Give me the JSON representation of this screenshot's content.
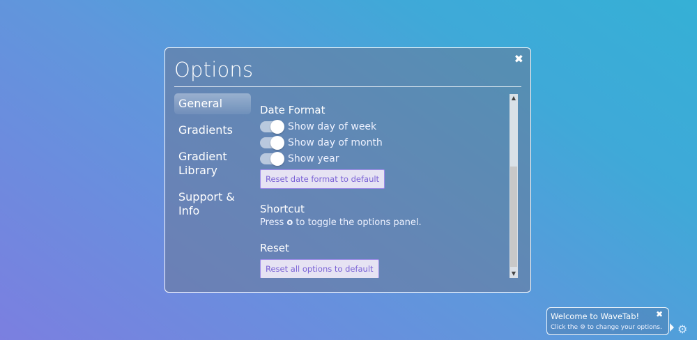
{
  "modal": {
    "title": "Options",
    "close_glyph": "✖"
  },
  "sidebar": {
    "items": [
      {
        "label": "General",
        "active": true
      },
      {
        "label": "Gradients"
      },
      {
        "label": "Gradient Library"
      },
      {
        "label": "Support & Info"
      }
    ]
  },
  "general": {
    "date_format": {
      "title": "Date Format",
      "toggles": [
        {
          "label": "Show day of week",
          "on": true
        },
        {
          "label": "Show day of month",
          "on": true
        },
        {
          "label": "Show year",
          "on": true
        }
      ],
      "reset_button": "Reset date format to default"
    },
    "shortcut": {
      "title": "Shortcut",
      "text_before": "Press ",
      "key": "o",
      "text_after": " to toggle the options panel."
    },
    "reset": {
      "title": "Reset",
      "button": "Reset all options to default"
    }
  },
  "welcome": {
    "title": "Welcome to WaveTab!",
    "close_glyph": "✖",
    "text_before": "Click the ",
    "text_after": " to change your options."
  },
  "icons": {
    "gear": "gear-icon",
    "close": "close-icon"
  }
}
